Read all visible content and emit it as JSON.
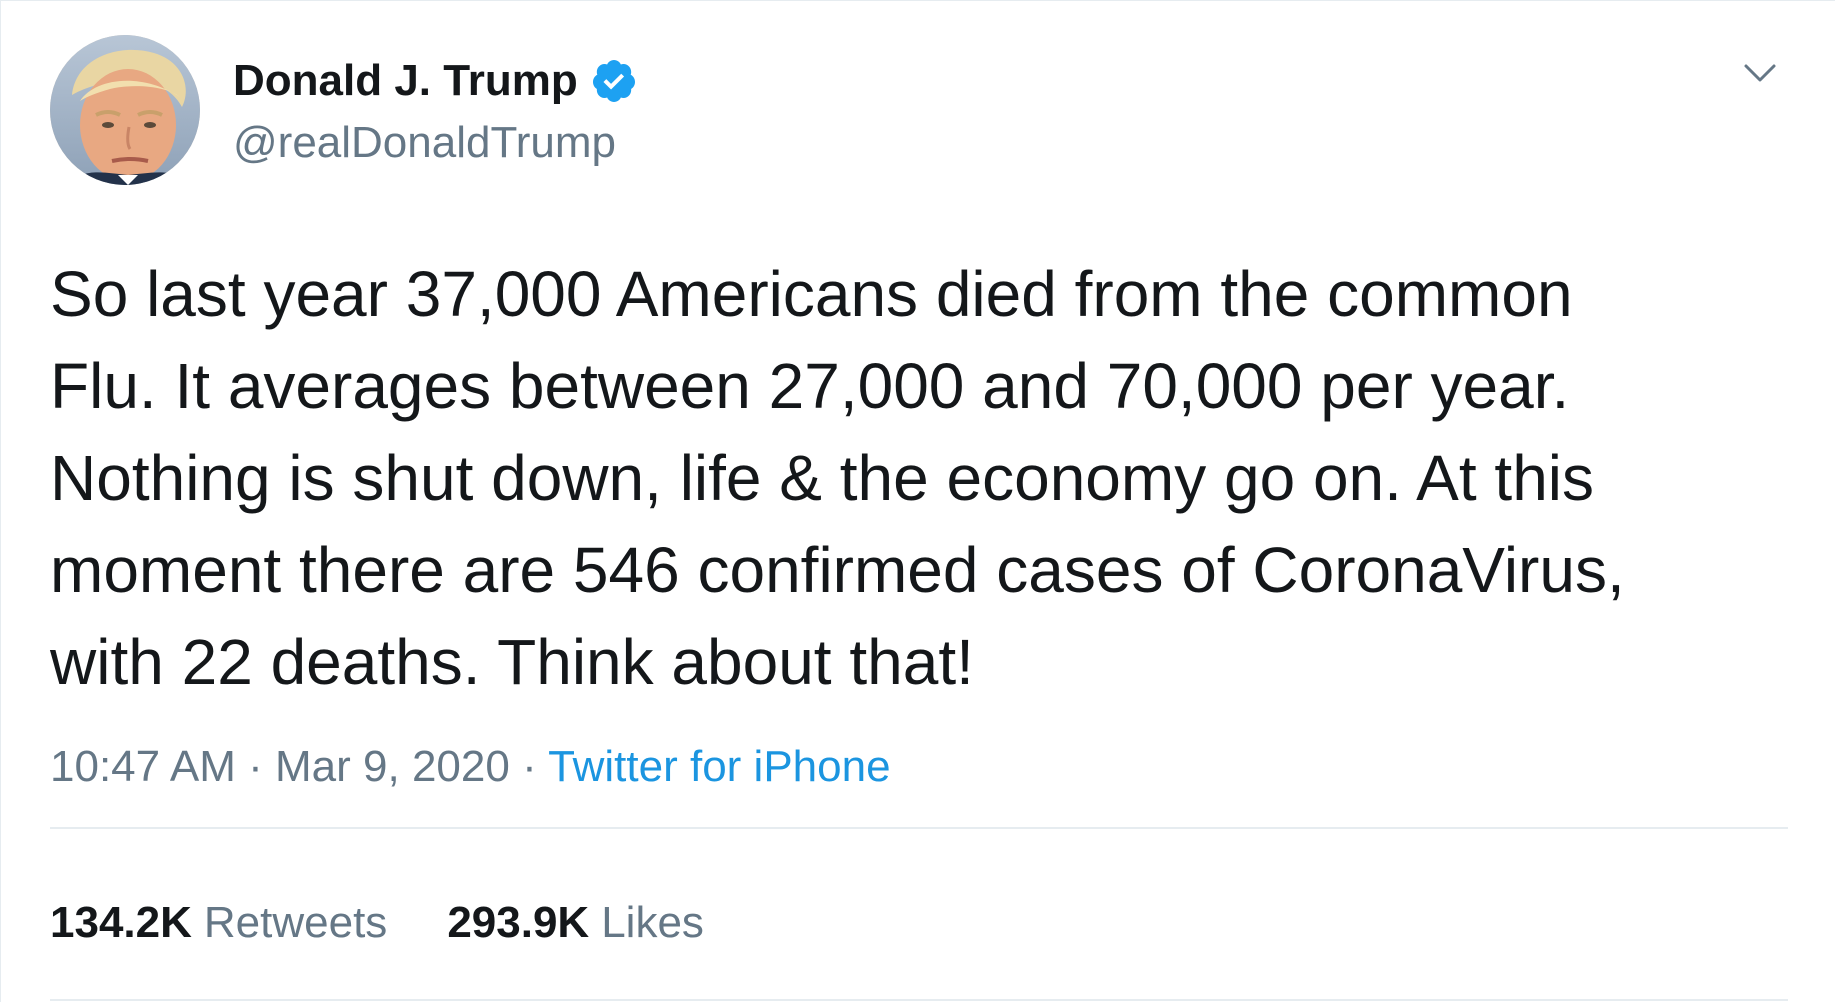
{
  "author": {
    "display_name": "Donald J. Trump",
    "handle": "@realDonaldTrump",
    "verified": true,
    "avatar_icon": "profile-photo"
  },
  "tweet": {
    "lines": [
      "So last year 37,000 Americans died from the common",
      "Flu. It averages between 27,000 and 70,000 per year.",
      "Nothing is shut down, life & the economy go on. At this",
      "moment there are 546 confirmed cases of CoronaVirus,",
      "with 22 deaths. Think about that!"
    ]
  },
  "meta": {
    "time": "10:47 AM",
    "separator": "·",
    "date": "Mar 9, 2020",
    "source": "Twitter for iPhone"
  },
  "stats": {
    "retweets": {
      "count": "134.2K",
      "label": "Retweets"
    },
    "likes": {
      "count": "293.9K",
      "label": "Likes"
    }
  },
  "colors": {
    "text": "#14171a",
    "secondary": "#657786",
    "link": "#1b95e0",
    "verified": "#1da1f2",
    "divider": "#e6ecf0"
  },
  "icons": {
    "verified": "verified-badge-icon",
    "caret": "chevron-down-icon"
  }
}
